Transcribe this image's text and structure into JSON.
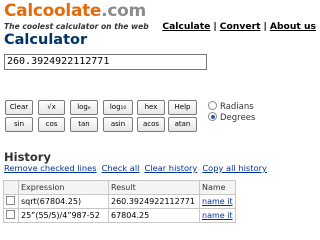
{
  "header": {
    "logo_part1": "Calcoolate",
    "logo_part2": ".com",
    "tagline": "The coolest calculator on the web",
    "nav": [
      {
        "label": "Calculate"
      },
      {
        "label": "Convert"
      },
      {
        "label": "About us"
      }
    ],
    "nav_separator": "|"
  },
  "calculator": {
    "title": "Calculator",
    "display_value": "260.3924922112771"
  },
  "keypad": {
    "row1": [
      "Clear",
      "√x",
      "logₑ",
      "log₁₀",
      "hex",
      "Help"
    ],
    "row2": [
      "sin",
      "cos",
      "tan",
      "asin",
      "acos",
      "atan"
    ]
  },
  "angle_mode": {
    "options": [
      {
        "label": "Radians",
        "selected": false
      },
      {
        "label": "Degrees",
        "selected": true
      }
    ]
  },
  "history": {
    "title": "History",
    "actions": [
      "Remove checked lines",
      "Check all",
      "Clear history",
      "Copy all history"
    ],
    "columns": [
      "",
      "Expression",
      "Result",
      "Name"
    ],
    "rows": [
      {
        "expression": "sqrt(67804.25)",
        "result": "260.3924922112771",
        "name": "name it"
      },
      {
        "expression": "25”(55/5)/4”987-52",
        "result": "67804.25",
        "name": "name it"
      }
    ]
  },
  "colors": {
    "logo_primary": "#e36c0a",
    "logo_secondary": "#8c8c8c",
    "title": "#003366",
    "link": "#00339a"
  }
}
